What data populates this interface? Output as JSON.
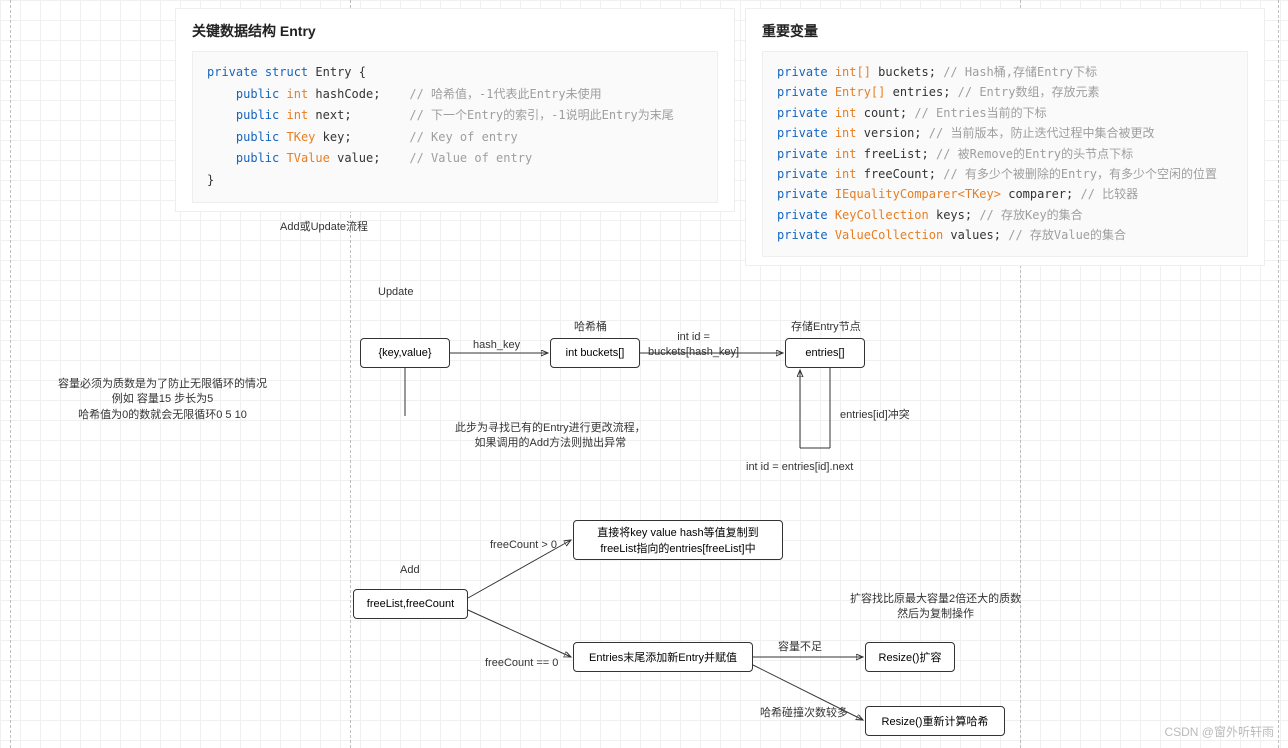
{
  "left_card": {
    "title": "关键数据结构 Entry",
    "line1_a": "private",
    "line1_b": "struct",
    "line1_c": "Entry {",
    "line2_a": "public",
    "line2_b": "int",
    "line2_c": "hashCode;",
    "line2_cm": "// 哈希值，-1代表此Entry未使用",
    "line3_a": "public",
    "line3_b": "int",
    "line3_c": "next;",
    "line3_cm": "// 下一个Entry的索引，-1说明此Entry为末尾",
    "line4_a": "public",
    "line4_b": "TKey",
    "line4_c": "key;",
    "line4_cm": "// Key of entry",
    "line5_a": "public",
    "line5_b": "TValue",
    "line5_c": "value;",
    "line5_cm": "// Value of entry",
    "line6": "}"
  },
  "right_card": {
    "title": "重要变量",
    "l1a": "private",
    "l1b": "int[]",
    "l1c": "buckets;",
    "l1cm": "// Hash桶,存储Entry下标",
    "l2a": "private",
    "l2b": "Entry[]",
    "l2c": "entries;",
    "l2cm": "// Entry数组，存放元素",
    "l3a": "private",
    "l3b": "int",
    "l3c": "count;",
    "l3cm": "// Entries当前的下标",
    "l4a": "private",
    "l4b": "int",
    "l4c": "version;",
    "l4cm": "// 当前版本，防止迭代过程中集合被更改",
    "l5a": "private",
    "l5b": "int",
    "l5c": "freeList;",
    "l5cm": "// 被Remove的Entry的头节点下标",
    "l6a": "private",
    "l6b": "int",
    "l6c": "freeCount;",
    "l6cm": "// 有多少个被删除的Entry，有多少个空闲的位置",
    "l7a": "private",
    "l7b": "IEqualityComparer<TKey>",
    "l7c": "comparer;",
    "l7cm": "// 比较器",
    "l8a": "private",
    "l8b": "KeyCollection",
    "l8c": "keys;",
    "l8cm": "// 存放Key的集合",
    "l9a": "private",
    "l9b": "ValueCollection",
    "l9c": "values;",
    "l9cm": "// 存放Value的集合"
  },
  "labels": {
    "add_update_flow": "Add或Update流程",
    "update": "Update",
    "hash_bucket": "哈希桶",
    "store_entry_node": "存储Entry节点",
    "hash_key": "hash_key",
    "int_id_buckets": "int id =\nbuckets[hash_key]",
    "entries_id_conflict": "entries[id]冲突",
    "int_id_next": "int id = entries[id].next",
    "find_entry_note": "此步为寻找已有的Entry进行更改流程，\n如果调用的Add方法则抛出异常",
    "prime_note": "容量必须为质数是为了防止无限循环的情况\n例如 容量15 步长为5\n哈希值为0的数就会无限循环0 5 10",
    "add": "Add",
    "freecount_gt0": "freeCount > 0",
    "freecount_eq0": "freeCount == 0",
    "capacity_insufficient": "容量不足",
    "collision_many": "哈希碰撞次数较多",
    "resize_note": "扩容找比原最大容量2倍还大的质数\n然后为复制操作"
  },
  "nodes": {
    "kv": "{key,value}",
    "buckets": "int buckets[]",
    "entries": "entries[]",
    "freelist": "freeList,freeCount",
    "copy_direct": "直接将key value hash等值复制到\nfreeList指向的entries[freeList]中",
    "append_entry": "Entries末尾添加新Entry并赋值",
    "resize": "Resize()扩容",
    "resize_rehash": "Resize()重新计算哈希"
  },
  "watermark": "CSDN @窗外听轩雨"
}
